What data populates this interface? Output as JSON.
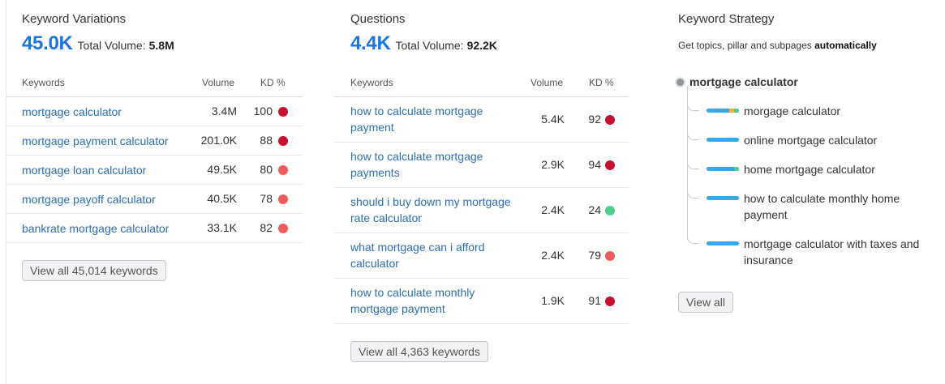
{
  "keyword_variations": {
    "title": "Keyword Variations",
    "count": "45.0K",
    "total_volume_label": "Total Volume:",
    "total_volume": "5.8M",
    "headers": {
      "keywords": "Keywords",
      "volume": "Volume",
      "kd": "KD %"
    },
    "rows": [
      {
        "keyword": "mortgage calculator",
        "volume": "3.4M",
        "kd": "100",
        "kd_color": "#c8102e"
      },
      {
        "keyword": "mortgage payment calculator",
        "volume": "201.0K",
        "kd": "88",
        "kd_color": "#c8102e"
      },
      {
        "keyword": "mortgage loan calculator",
        "volume": "49.5K",
        "kd": "80",
        "kd_color": "#f05a5a"
      },
      {
        "keyword": "mortgage payoff calculator",
        "volume": "40.5K",
        "kd": "78",
        "kd_color": "#f05a5a"
      },
      {
        "keyword": "bankrate mortgage calculator",
        "volume": "33.1K",
        "kd": "82",
        "kd_color": "#f05a5a"
      }
    ],
    "view_all": "View all 45,014 keywords"
  },
  "questions": {
    "title": "Questions",
    "count": "4.4K",
    "total_volume_label": "Total Volume:",
    "total_volume": "92.2K",
    "headers": {
      "keywords": "Keywords",
      "volume": "Volume",
      "kd": "KD %"
    },
    "rows": [
      {
        "keyword": "how to calculate mortgage payment",
        "volume": "5.4K",
        "kd": "92",
        "kd_color": "#c8102e"
      },
      {
        "keyword": "how to calculate mortgage payments",
        "volume": "2.9K",
        "kd": "94",
        "kd_color": "#c8102e"
      },
      {
        "keyword": "should i buy down my mortgage rate calculator",
        "volume": "2.4K",
        "kd": "24",
        "kd_color": "#4fd08a"
      },
      {
        "keyword": "what mortgage can i afford calculator",
        "volume": "2.4K",
        "kd": "79",
        "kd_color": "#f05a5a"
      },
      {
        "keyword": "how to calculate monthly mortgage payment",
        "volume": "1.9K",
        "kd": "91",
        "kd_color": "#c8102e"
      }
    ],
    "view_all": "View all 4,363 keywords"
  },
  "keyword_strategy": {
    "title": "Keyword Strategy",
    "subtitle_prefix": "Get topics, pillar and subpages ",
    "subtitle_bold": "automatically",
    "root": "mortgage calculator",
    "subpages": [
      {
        "label": "morgage calculator",
        "accent": "#f2b233",
        "accent2": "#4fd08a"
      },
      {
        "label": "online mortgage calculator",
        "accent": "",
        "accent2": ""
      },
      {
        "label": "home mortgage calculator",
        "accent": "#4fd08a",
        "accent2": ""
      },
      {
        "label": "how to calculate monthly home payment",
        "accent": "",
        "accent2": ""
      },
      {
        "label": "mortgage calculator with taxes and insurance",
        "accent": "",
        "accent2": ""
      }
    ],
    "view_all": "View all"
  }
}
